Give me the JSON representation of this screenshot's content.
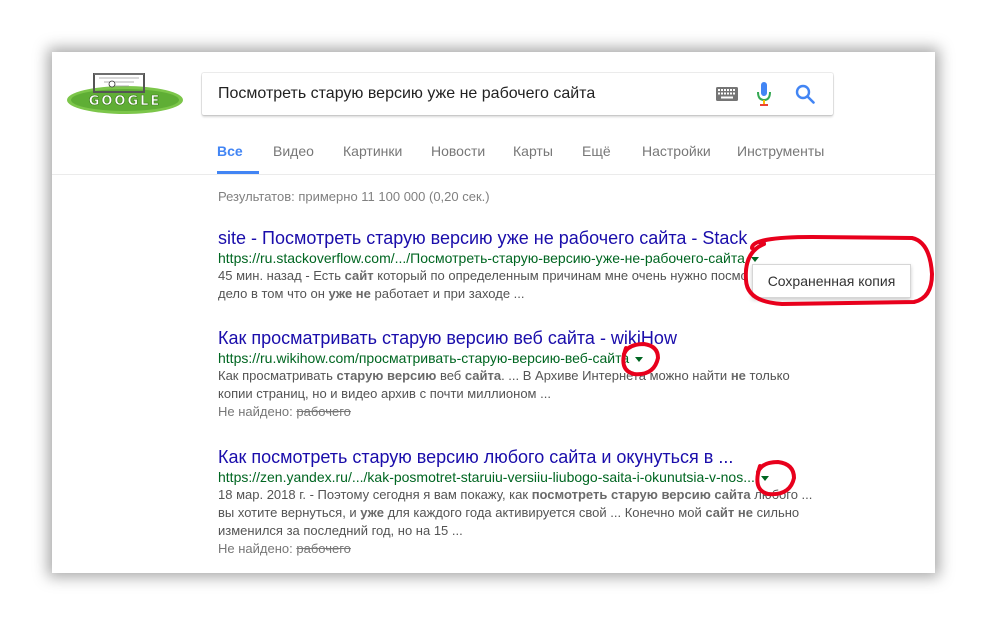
{
  "search": {
    "query": "Посмотреть старую версию уже не рабочего сайта"
  },
  "tabs": [
    {
      "label": "Все",
      "active": true
    },
    {
      "label": "Видео"
    },
    {
      "label": "Картинки"
    },
    {
      "label": "Новости"
    },
    {
      "label": "Карты"
    },
    {
      "label": "Ещё"
    },
    {
      "label": "Настройки"
    },
    {
      "label": "Инструменты"
    }
  ],
  "stats": "Результатов: примерно 11 100 000 (0,20 сек.)",
  "results": [
    {
      "title": "site - Посмотреть старую версию уже не рабочего сайта - Stack ...",
      "url": "https://ru.stackoverflow.com/.../Посмотреть-старую-версию-уже-не-рабочего-сайта",
      "snippet_line1_a": "45 мин. назад - Есть ",
      "snippet_line1_b": "сайт",
      "snippet_line1_c": " который по определенным причинам мне очень нужно посмо",
      "snippet_line2_a": "дело в том что он ",
      "snippet_line2_b": "уже не",
      "snippet_line2_c": " работает и при заходе ..."
    },
    {
      "title": "Как просматривать старую версию веб сайта - wikiHow",
      "url": "https://ru.wikihow.com/просматривать-старую-версию-веб-сайта",
      "snippet_line1_a": "Как просматривать ",
      "snippet_line1_b": "старую версию",
      "snippet_line1_c": " веб ",
      "snippet_line1_d": "сайта",
      "snippet_line1_e": ". ... В Архиве Интернета можно найти ",
      "snippet_line1_f": "не",
      "snippet_line1_g": " только",
      "snippet_line2": "копии страниц, но и видео архив с почти миллионом ...",
      "missing_label": "Не найдено: ",
      "missing_word": "рабочего"
    },
    {
      "title": "Как посмотреть старую версию любого сайта и окунуться в ...",
      "url": "https://zen.yandex.ru/.../kak-posmotret-staruiu-versiiu-liubogo-saita-i-okunutsia-v-nos...",
      "snippet_line1_a": "18 мар. 2018 г. - Поэтому сегодня я вам покажу, как ",
      "snippet_line1_b": "посмотреть старую версию сайта",
      "snippet_line1_c": " любого ...",
      "snippet_line2_a": "вы хотите вернуться, и ",
      "snippet_line2_b": "уже",
      "snippet_line2_c": " для каждого года активируется свой ... Конечно мой ",
      "snippet_line2_d": "сайт не",
      "snippet_line2_e": " сильно",
      "snippet_line3": "изменился за последний год, но на 15 ...",
      "missing_label": "Не найдено: ",
      "missing_word": "рабочего"
    }
  ],
  "popup": {
    "label": "Сохраненная копия"
  },
  "colors": {
    "link": "#1a0dab",
    "url": "#006621",
    "accent": "#4285f4",
    "annotation": "#e8001c"
  }
}
